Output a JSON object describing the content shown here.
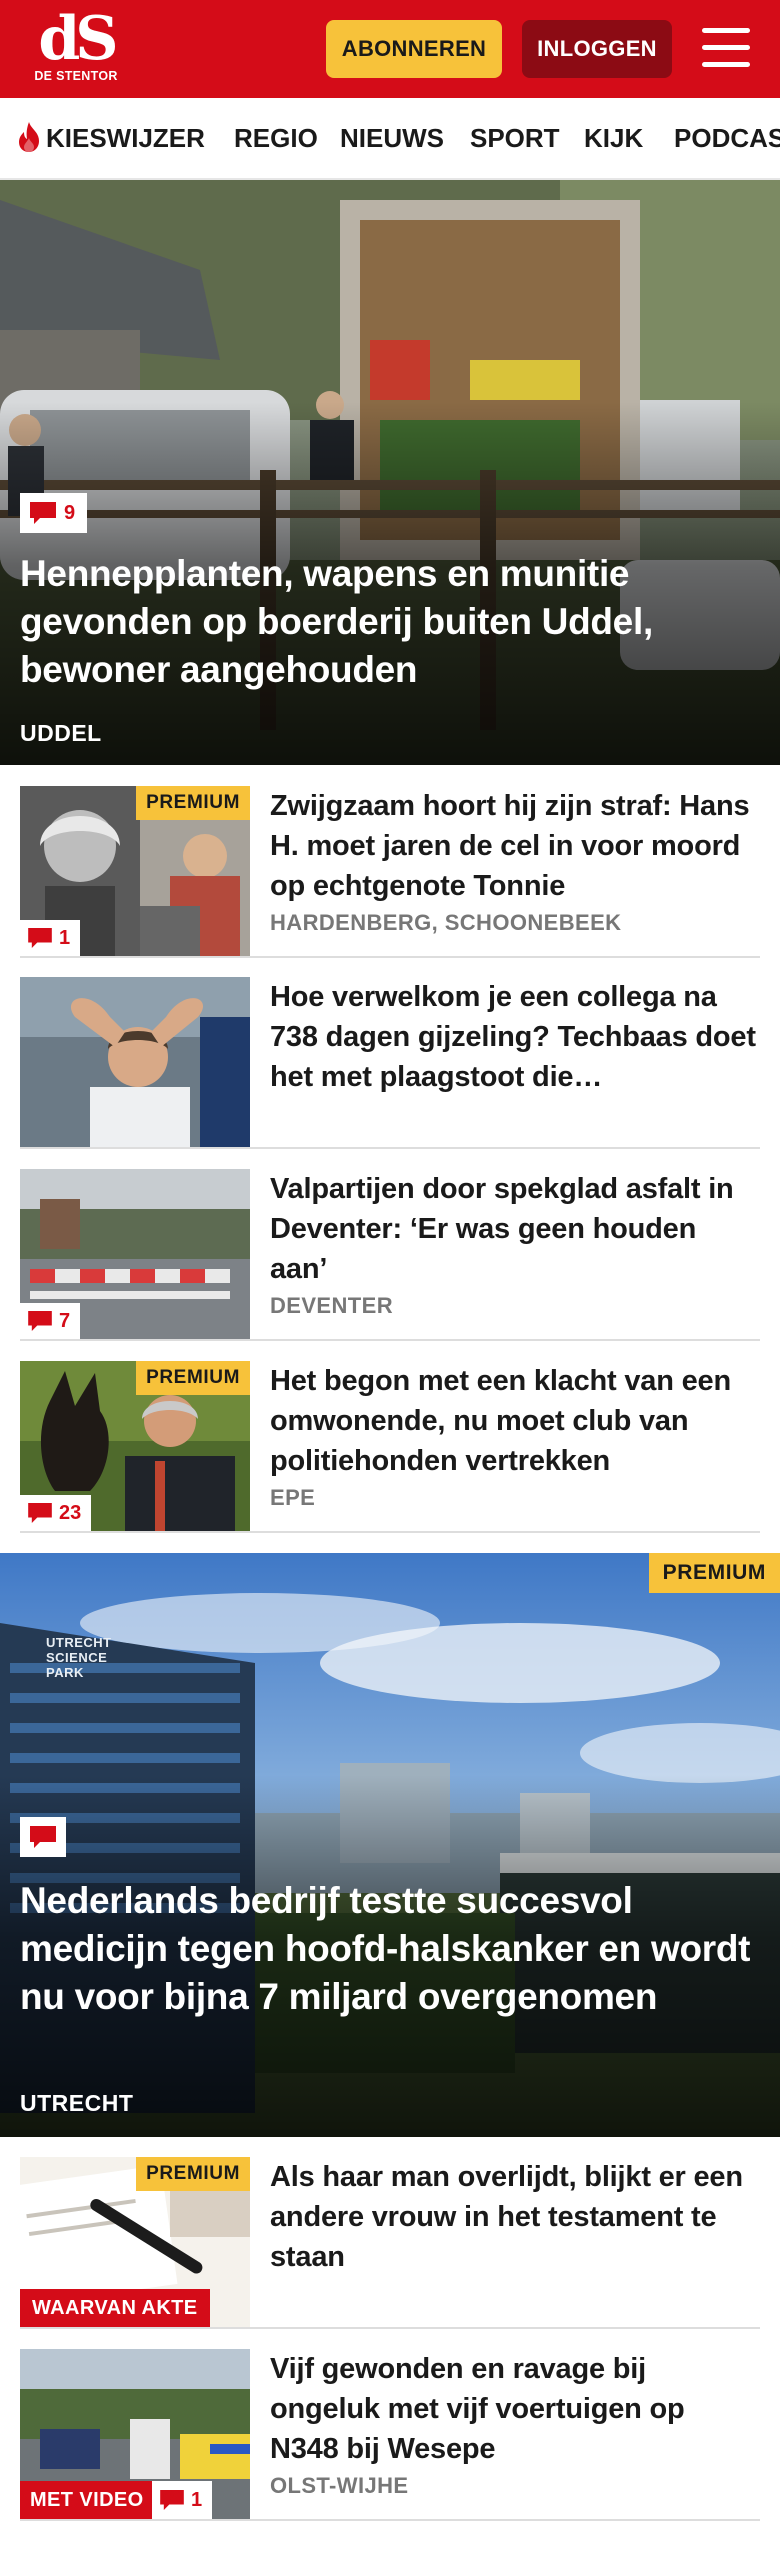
{
  "header": {
    "logo_mark": "dS",
    "logo_sub": "DE STENTOR",
    "subscribe_label": "ABONNEREN",
    "login_label": "INLOGGEN",
    "brand_color": "#d40c18",
    "accent_color": "#f7c23a"
  },
  "nav": {
    "items": [
      {
        "label": "KIESWIJZER",
        "icon": "flame-icon"
      },
      {
        "label": "REGIO"
      },
      {
        "label": "NIEUWS"
      },
      {
        "label": "SPORT"
      },
      {
        "label": "KIJK"
      },
      {
        "label": "PODCASTS"
      }
    ]
  },
  "articles": {
    "hero1": {
      "comments": "9",
      "title": "Hennepplanten, wapens en munitie gevonden op boerderij buiten Uddel, bewoner aangehouden",
      "location": "UDDEL"
    },
    "list1": [
      {
        "title": "Zwijgzaam hoort hij zijn straf: Hans H. moet jaren de cel in voor moord op echtgenote Tonnie",
        "location": "HARDENBERG, SCHOONEBEEK",
        "premium": "PREMIUM",
        "comments": "1"
      },
      {
        "title": "Hoe verwelkom je een collega na 738 dagen gijzeling? Techbaas doet het met plaagstoot die…"
      },
      {
        "title": "Valpartijen door spekglad asfalt in Deventer: ‘Er was geen houden aan’",
        "location": "DEVENTER",
        "comments": "7"
      },
      {
        "title": "Het begon met een klacht van een omwonende, nu moet club van politiehonden vertrekken",
        "location": "EPE",
        "premium": "PREMIUM",
        "comments": "23"
      }
    ],
    "hero2": {
      "premium": "PREMIUM",
      "title": "Nederlands bedrijf testte succesvol medicijn tegen hoofd-halskanker en wordt nu voor bijna 7 miljard overgenomen",
      "location": "UTRECHT",
      "building_sign": "UTRECHT SCIENCE PARK"
    },
    "list2": [
      {
        "title": "Als haar man overlijdt, blijkt er een andere vrouw in het testament te staan",
        "premium": "PREMIUM",
        "label": "WAARVAN AKTE"
      },
      {
        "title": "Vijf gewonden en ravage bij ongeluk met vijf voertuigen op N348 bij Wesepe",
        "location": "OLST-WIJHE",
        "label": "MET VIDEO",
        "comments": "1"
      }
    ]
  }
}
